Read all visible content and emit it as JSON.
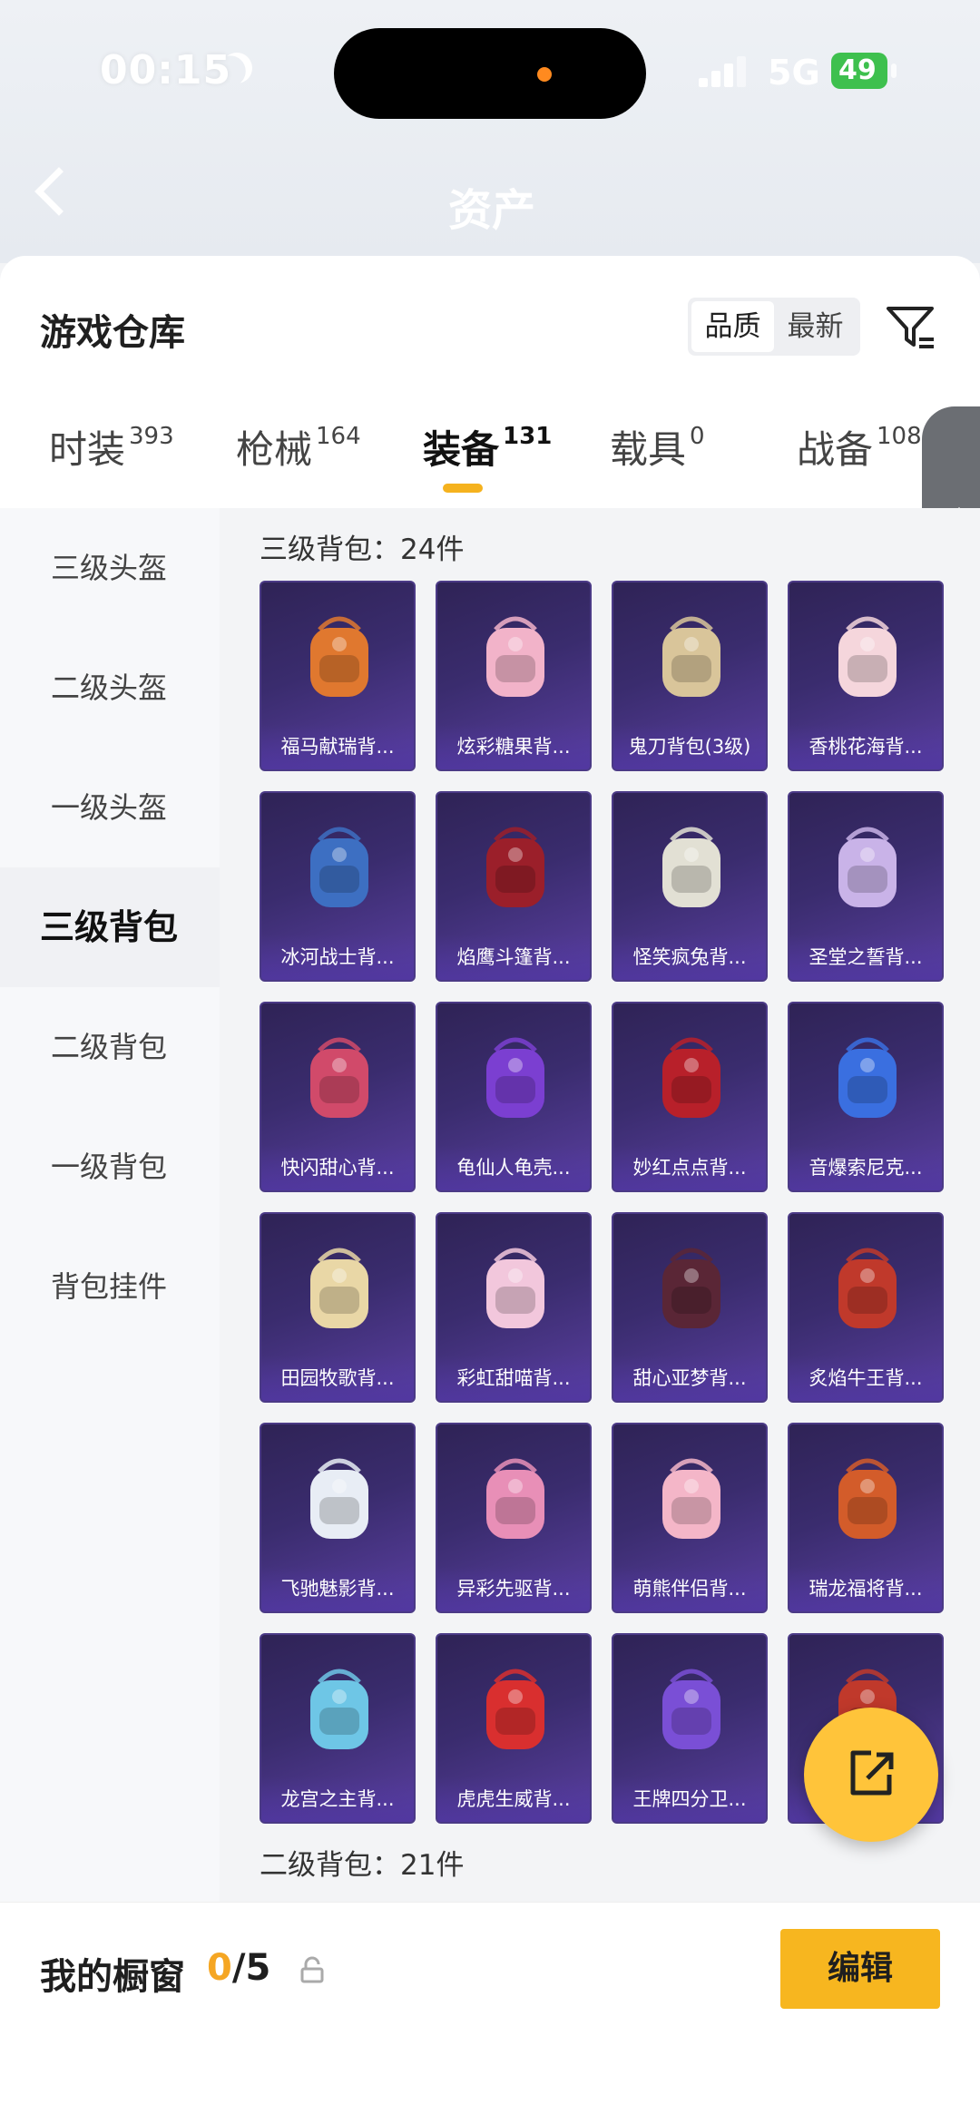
{
  "status_bar": {
    "time": "00:15",
    "network": "5G",
    "battery": "49"
  },
  "nav": {
    "title": "资产"
  },
  "header": {
    "title": "游戏仓库",
    "sort_options": [
      "品质",
      "最新"
    ],
    "sort_active": "品质"
  },
  "tabs": [
    {
      "label": "时装",
      "count": "393"
    },
    {
      "label": "枪械",
      "count": "164"
    },
    {
      "label": "装备",
      "count": "131",
      "active": true
    },
    {
      "label": "载具",
      "count": "0"
    },
    {
      "label": "战备",
      "count": "108"
    }
  ],
  "subnav": [
    {
      "label": "三级头盔"
    },
    {
      "label": "二级头盔"
    },
    {
      "label": "一级头盔"
    },
    {
      "label": "三级背包",
      "active": true
    },
    {
      "label": "二级背包"
    },
    {
      "label": "一级背包"
    },
    {
      "label": "背包挂件"
    }
  ],
  "sections": [
    {
      "title": "三级背包：24件",
      "items": [
        {
          "name": "福马献瑞背...",
          "icon": "rabbit-backpack-icon",
          "color": "#e0782f"
        },
        {
          "name": "炫彩糖果背...",
          "icon": "donut-backpack-icon",
          "color": "#f2b3c9"
        },
        {
          "name": "鬼刀背包(3级)",
          "icon": "blade-backpack-icon",
          "color": "#d9c59a"
        },
        {
          "name": "香桃花海背...",
          "icon": "peach-backpack-icon",
          "color": "#f5d6dc"
        },
        {
          "name": "冰河战士背...",
          "icon": "warrior-backpack-icon",
          "color": "#3d6fc2"
        },
        {
          "name": "焰鹰斗篷背...",
          "icon": "hawk-backpack-icon",
          "color": "#9b1f2a"
        },
        {
          "name": "怪笑疯兔背...",
          "icon": "crazy-rabbit-backpack-icon",
          "color": "#e2e0d4"
        },
        {
          "name": "圣堂之誓背...",
          "icon": "temple-backpack-icon",
          "color": "#c9b3e8"
        },
        {
          "name": "快闪甜心背...",
          "icon": "sweetheart-backpack-icon",
          "color": "#d14a6a"
        },
        {
          "name": "龟仙人龟壳...",
          "icon": "turtle-shell-backpack-icon",
          "color": "#7b3fd1"
        },
        {
          "name": "妙红点点背...",
          "icon": "red-dot-backpack-icon",
          "color": "#b8202a"
        },
        {
          "name": "音爆索尼克...",
          "icon": "sonic-backpack-icon",
          "color": "#3a6fe0"
        },
        {
          "name": "田园牧歌背...",
          "icon": "basket-backpack-icon",
          "color": "#e9d7a6"
        },
        {
          "name": "彩虹甜喵背...",
          "icon": "cat-backpack-icon",
          "color": "#f2c7dc"
        },
        {
          "name": "甜心亚梦背...",
          "icon": "dream-backpack-icon",
          "color": "#5a2636"
        },
        {
          "name": "炙焰牛王背...",
          "icon": "bull-king-backpack-icon",
          "color": "#c0392b"
        },
        {
          "name": "飞驰魅影背...",
          "icon": "phantom-backpack-icon",
          "color": "#e8edf5"
        },
        {
          "name": "异彩先驱背...",
          "icon": "pioneer-backpack-icon",
          "color": "#e88fb7"
        },
        {
          "name": "萌熊伴侣背...",
          "icon": "bear-backpack-icon",
          "color": "#f4b6c8"
        },
        {
          "name": "瑞龙福将背...",
          "icon": "dragon-general-backpack-icon",
          "color": "#d35c2a"
        },
        {
          "name": "龙宫之主背...",
          "icon": "dragon-palace-backpack-icon",
          "color": "#6ec6e6"
        },
        {
          "name": "虎虎生威背...",
          "icon": "tiger-backpack-icon",
          "color": "#d92f2f"
        },
        {
          "name": "王牌四分卫...",
          "icon": "quarterback-backpack-icon",
          "color": "#7a4fd6"
        },
        {
          "name": "",
          "icon": "partial-backpack-icon",
          "color": "#c0392b"
        }
      ]
    },
    {
      "title": "二级背包：21件",
      "items": []
    }
  ],
  "bottom": {
    "showcase_label": "我的橱窗",
    "showcase_current": "0",
    "showcase_total": "/5",
    "edit_label": "编辑"
  },
  "colors": {
    "accent": "#f7b61f",
    "item_bg": "#3a2c6e"
  }
}
